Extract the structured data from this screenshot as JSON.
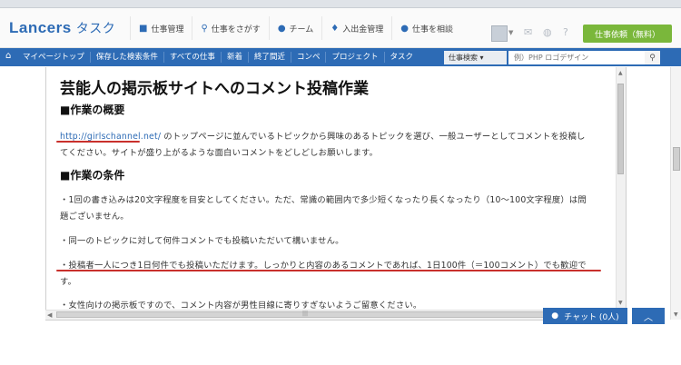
{
  "header": {
    "logo_main": "Lancers",
    "logo_sub": "タスク",
    "nav": [
      {
        "label": "仕事管理",
        "icon": "briefcase-icon"
      },
      {
        "label": "仕事をさがす",
        "icon": "search-icon"
      },
      {
        "label": "チーム",
        "icon": "team-icon"
      },
      {
        "label": "入出金管理",
        "icon": "money-bag-icon"
      },
      {
        "label": "仕事を相談",
        "icon": "chat-bubble-icon"
      }
    ],
    "cta_label": "仕事依頼（無料）"
  },
  "subnav": {
    "items": [
      "マイページトップ",
      "保存した検索条件",
      "すべての仕事",
      "新着",
      "終了間近",
      "コンペ",
      "プロジェクト",
      "タスク"
    ],
    "search_type": "仕事検索 ▾",
    "search_placeholder": "例）PHP ロゴデザイン"
  },
  "article": {
    "title": "芸能人の掲示板サイトへのコメント投稿作業",
    "section1_heading": "■作業の概要",
    "overview_link": "http://girlschannel.net/",
    "overview_line1_rest": " のトップページに並んでいるトピックから興味のあるトピックを選び、一般ユーザーとしてコメントを投稿し",
    "overview_line2": "てください。サイトが盛り上がるような面白いコメントをどしどしお願いします。",
    "section2_heading": "■作業の条件",
    "cond1_line1": "・1回の書き込みは20文字程度を目安としてください。ただ、常識の範囲内で多少短くなったり長くなったり（10〜100文字程度）は問",
    "cond1_line2": "題ございません。",
    "cond2": "・同一のトピックに対して何件コメントでも投稿いただいて構いません。",
    "cond3_line1": "・投稿者一人につき1日何件でも投稿いただけます。しっかりと内容のあるコメントであれば、1日100件（＝100コメント）でも歓迎で",
    "cond3_line2": "す。",
    "cond4": "・女性向けの掲示板ですので、コメント内容が男性目線に寄りすぎないようご留意ください。"
  },
  "chat": {
    "label": "チャット (0人)"
  },
  "colors": {
    "brand_blue": "#2d6bb5",
    "cta_green": "#7ab73b",
    "annotation_red": "#c9302c"
  }
}
